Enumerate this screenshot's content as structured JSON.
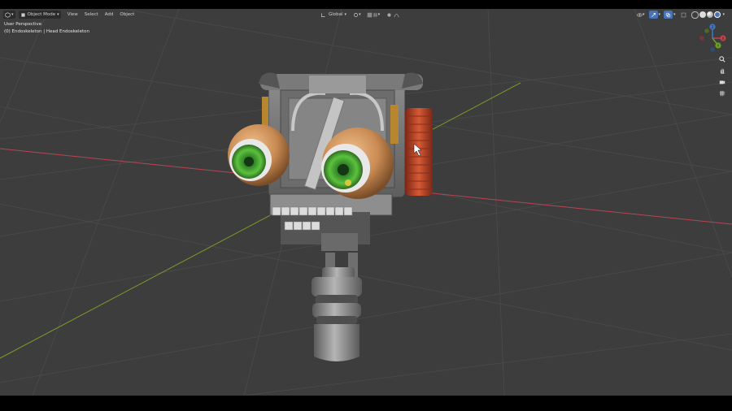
{
  "header": {
    "mode_label": "Object Mode",
    "menus": [
      "View",
      "Select",
      "Add",
      "Object"
    ],
    "transform_orientation": "Global"
  },
  "overlay": {
    "view_name": "User Perspective",
    "object_info": "(0) Endoskeleton | Head Endoskeleton"
  },
  "gizmo": {
    "x_label": "X",
    "y_label": "Y",
    "z_label": "Z"
  },
  "colors": {
    "viewport_bg": "#3d3d3d",
    "grid_line": "#4a4a4a",
    "x_axis": "#b5474f",
    "y_axis": "#7a9a2a",
    "eye_iris": "#4fae2f",
    "eye_ball": "#c98a52",
    "coil": "#c0472a"
  },
  "icons": {
    "editor_type": "cube-icon",
    "viewport_shading": [
      "wireframe-icon",
      "solid-icon",
      "material-icon",
      "rendered-icon"
    ],
    "nav": [
      "zoom-icon",
      "hand-icon",
      "camera-icon",
      "grid-icon"
    ]
  }
}
